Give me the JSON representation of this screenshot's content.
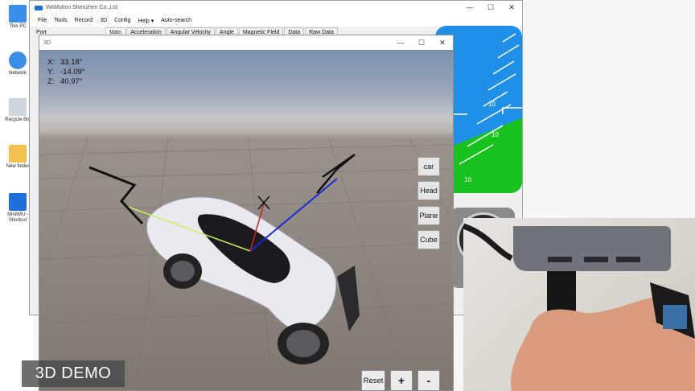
{
  "desktop": {
    "icons": [
      {
        "label": "This PC",
        "icon": "computer-icon",
        "color": "#3b8ee8"
      },
      {
        "label": "Network",
        "icon": "network-icon",
        "color": "#3b8ee8"
      },
      {
        "label": "Recycle Bin",
        "icon": "recycle-bin-icon",
        "color": "#9aa6b2"
      },
      {
        "label": "New folder",
        "icon": "folder-icon",
        "color": "#f2c14e"
      },
      {
        "label": "MiniIMU - Shortcut",
        "icon": "app-shortcut-icon",
        "color": "#1e6fd9"
      }
    ]
  },
  "app": {
    "title": "WitMotion Shenzhen Co.,Ltd",
    "menu": [
      "File",
      "Tools",
      "Record",
      "3D",
      "Config",
      "Help ▾",
      "Auto-search"
    ],
    "tabs": [
      "Main",
      "Acceleration",
      "Angular Velocity",
      "Angle",
      "Magnetic Field",
      "Data",
      "Raw Data"
    ],
    "active_tab": "Main",
    "port_label": "Port",
    "window_controls": {
      "minimize": "—",
      "maximize": "☐",
      "close": "✕"
    },
    "gauge_numbers": [
      "10",
      "10",
      "10",
      "10"
    ]
  },
  "win3d": {
    "title": "3D",
    "readout": {
      "x_label": "X:",
      "x_value": "33.18°",
      "y_label": "Y:",
      "y_value": "-14.09°",
      "z_label": "Z:",
      "z_value": "40.97°"
    },
    "view_buttons": [
      "car",
      "Head",
      "Plane",
      "Cube"
    ],
    "reset_label": "Reset",
    "plus_label": "+",
    "minus_label": "-"
  },
  "overlay": {
    "demo_label": "3D DEMO"
  },
  "colors": {
    "sky": "#1f8fe8",
    "ground": "#17c21f",
    "axis_blue": "#1a2ad6",
    "axis_red": "#d02020",
    "axis_green": "#c8f060"
  }
}
